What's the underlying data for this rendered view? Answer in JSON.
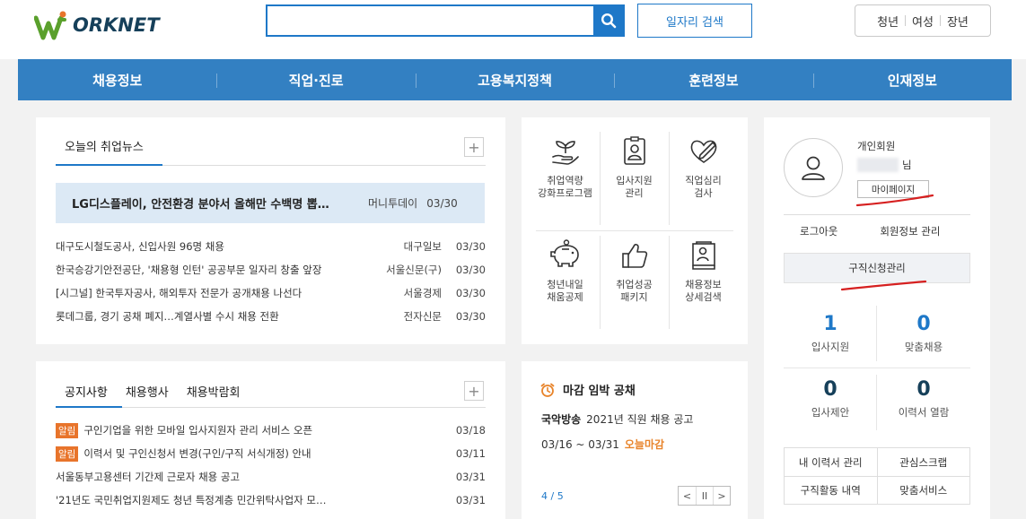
{
  "header": {
    "logo_text": "ORKNET",
    "search": {
      "value": "",
      "placeholder": ""
    },
    "job_search_label": "일자리 검색",
    "age_filters": [
      "청년",
      "여성",
      "장년"
    ]
  },
  "nav": [
    "채용정보",
    "직업·진로",
    "고용복지정책",
    "훈련정보",
    "인재정보"
  ],
  "news": {
    "title": "오늘의 취업뉴스",
    "plus": "+",
    "headline": {
      "title": "LG디스플레이, 안전환경 분야서 올해만 수백명 뽑…",
      "source": "머니투데이",
      "date": "03/30"
    },
    "items": [
      {
        "title": "대구도시철도공사, 신입사원 96명 채용",
        "source": "대구일보",
        "date": "03/30"
      },
      {
        "title": "한국승강기안전공단, '채용형 인턴' 공공부문 일자리 창출 앞장",
        "source": "서울신문(구)",
        "date": "03/30"
      },
      {
        "title": "[시그널] 한국투자공사, 해외투자 전문가 공개채용 나선다",
        "source": "서울경제",
        "date": "03/30"
      },
      {
        "title": "롯데그룹, 경기 공채 폐지…계열사별 수시 채용 전환",
        "source": "전자신문",
        "date": "03/30"
      }
    ]
  },
  "notices": {
    "tabs": [
      "공지사항",
      "채용행사",
      "채용박람회"
    ],
    "plus": "+",
    "items": [
      {
        "badge": "알림",
        "title": "구인기업을 위한 모바일 입사지원자 관리 서비스 오픈",
        "date": "03/18"
      },
      {
        "badge": "알림",
        "title": "이력서 및 구인신청서 변경(구인/구직 서식개정) 안내",
        "date": "03/11"
      },
      {
        "badge": "",
        "title": "서울동부고용센터 기간제 근로자 채용 공고",
        "date": "03/31"
      },
      {
        "badge": "",
        "title": "'21년도 국민취업지원제도 청년 특정계층 민간위탁사업자 모…",
        "date": "03/31"
      }
    ]
  },
  "services": [
    {
      "label": "취업역량\n강화프로그램",
      "icon": "seedling-hand-icon"
    },
    {
      "label": "입사지원\n관리",
      "icon": "id-badge-icon"
    },
    {
      "label": "직업심리\n검사",
      "icon": "heart-pen-icon"
    },
    {
      "label": "청년내일\n채움공제",
      "icon": "piggy-bank-icon"
    },
    {
      "label": "취업성공\n패키지",
      "icon": "thumbs-up-icon"
    },
    {
      "label": "채용정보\n상세검색",
      "icon": "document-search-icon"
    }
  ],
  "deadline": {
    "title": "마감 임박 공채",
    "company": "국악방송",
    "job": "2021년 직원 채용 공고",
    "period": "03/16 ~ 03/31",
    "today": "오늘마감",
    "page": "4 / 5",
    "controls": [
      "<",
      "II",
      ">"
    ]
  },
  "member": {
    "type": "개인회원",
    "suffix": "님",
    "mypage": "마이페이지",
    "logout": "로그아웃",
    "edit_info": "회원정보 관리",
    "apply_mgmt": "구직신청관리",
    "stats": [
      {
        "value": "1",
        "label": "입사지원"
      },
      {
        "value": "0",
        "label": "맞춤채용"
      },
      {
        "value": "0",
        "label": "입사제안"
      },
      {
        "value": "0",
        "label": "이력서 열람"
      }
    ],
    "links": [
      "내 이력서 관리",
      "관심스크랩",
      "구직활동 내역",
      "맞춤서비스"
    ]
  },
  "colors": {
    "primary": "#1e78c8",
    "nav": "#3380c2",
    "accent_orange": "#e8742b",
    "highlight": "#dce9f5"
  }
}
